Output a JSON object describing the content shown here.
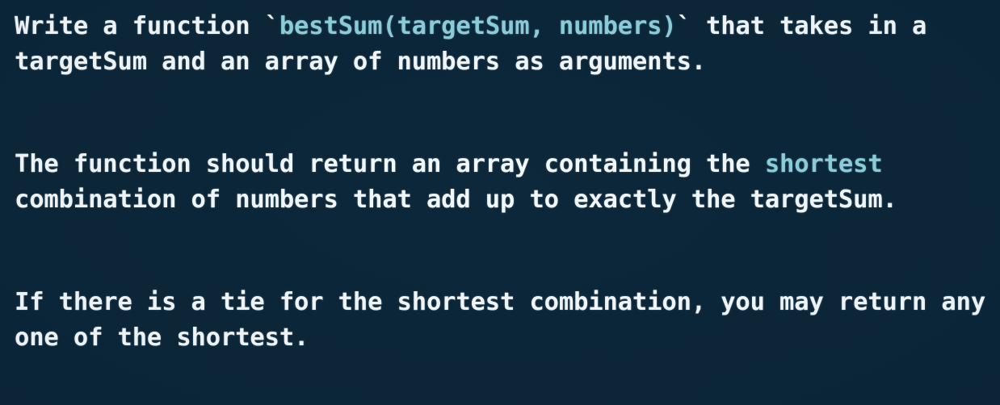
{
  "colors": {
    "background": "#0a2538",
    "text": "#f2f7f9",
    "accent_teal": "#8acfdb"
  },
  "content": {
    "paragraphs": [
      {
        "id": "paragraph-1",
        "plain_text": "Write a function `bestSum(targetSum, numbers)` that takes in a targetSum and an array of numbers as arguments.",
        "segments": {
          "lead": "Write a function ",
          "open_tick": "`",
          "code": "bestSum(targetSum, numbers)",
          "close_tick": "`",
          "tail": " that takes in a targetSum and an array of numbers as arguments."
        }
      },
      {
        "id": "paragraph-2",
        "plain_text": "The function should return an array containing the shortest combination of numbers that add up to exactly the targetSum.",
        "segments": {
          "lead": "The function should return an array containing the ",
          "highlight": "shortest",
          "tail": " combination of numbers that add up to exactly the targetSum."
        }
      },
      {
        "id": "paragraph-3",
        "plain_text": "If there is a tie for the shortest combination, you may return any one of the shortest.",
        "segments": {
          "lead": "If there is a tie for the shortest combination, you may return any one of the shortest."
        }
      }
    ]
  }
}
